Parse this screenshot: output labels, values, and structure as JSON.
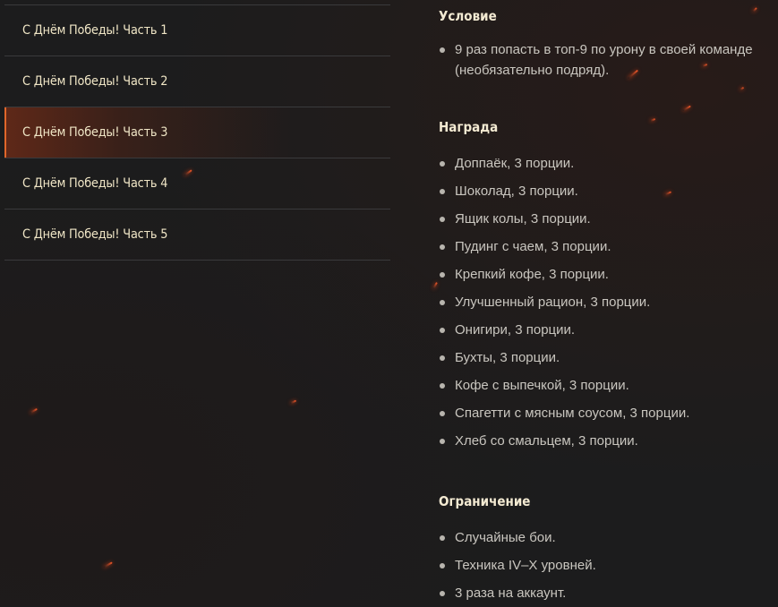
{
  "sidebar": {
    "items": [
      {
        "label": "С Днём Победы! Часть 1"
      },
      {
        "label": "С Днём Победы! Часть 2"
      },
      {
        "label": "С Днём Победы! Часть 3"
      },
      {
        "label": "С Днём Победы! Часть 4"
      },
      {
        "label": "С Днём Победы! Часть 5"
      }
    ],
    "active_index": 2
  },
  "condition": {
    "title": "Условие",
    "items": [
      {
        "line1": "9 раз попасть в топ-9 по урону в своей команде",
        "line2": "(необязательно подряд)."
      }
    ]
  },
  "reward": {
    "title": "Награда",
    "items": [
      "Доппаёк, 3 порции.",
      "Шоколад, 3 порции.",
      "Ящик колы, 3 порции.",
      "Пудинг с чаем, 3 порции.",
      "Крепкий кофе, 3 порции.",
      "Улучшенный рацион, 3 порции.",
      "Онигири, 3 порции.",
      "Бухты, 3 порции.",
      "Кофе с выпечкой, 3 порции.",
      "Спагетти с мясным соусом, 3 порции.",
      "Хлеб со смальцем, 3 порции."
    ]
  },
  "limit": {
    "title": "Ограничение",
    "items": [
      "Случайные бои.",
      "Техника IV–X уровней.",
      "3 раза на аккаунт."
    ]
  },
  "colors": {
    "background": "#1c1c1d",
    "accent": "#e0662a",
    "nav_text": "#f0e6c6",
    "body_text": "#c9c6bf"
  }
}
